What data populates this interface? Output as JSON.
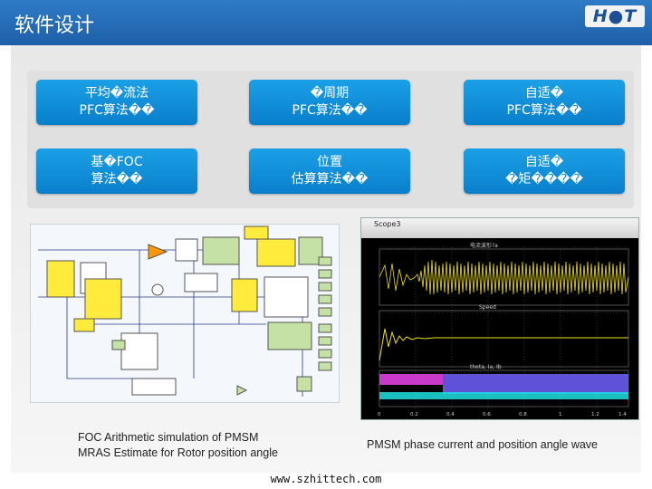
{
  "header": {
    "title": "软件设计",
    "logo": "H●T"
  },
  "boxes": [
    {
      "line1": "平均�流法",
      "line2": "PFC算法��"
    },
    {
      "line1": "�周期",
      "line2": "PFC算法��"
    },
    {
      "line1": "自适�",
      "line2": "PFC算法��"
    },
    {
      "line1": "基�FOC",
      "line2": "算法��"
    },
    {
      "line1": "位置",
      "line2": "估算算法��"
    },
    {
      "line1": "自适�",
      "line2": "�矩����"
    }
  ],
  "simulation": {
    "caption_line1": "FOC Arithmetic simulation of PMSM",
    "caption_line2": "MRAS Estimate for Rotor position angle"
  },
  "scope": {
    "window_name": "Scope3",
    "plot1_label": "电流波形?a",
    "plot2_label": "Speed",
    "plot3_label": "theta, Ia, Ib",
    "x_ticks": [
      "0",
      "0.2",
      "0.4",
      "0.6",
      "0.8",
      "1",
      "1.2",
      "1.4"
    ],
    "caption": "PMSM phase current and position angle wave"
  },
  "footer": "www.szhittech.com",
  "colors": {
    "header": "#1f5fa8",
    "box": "#0a7fcc",
    "trace_yellow": "#f0e020",
    "trace_magenta": "#e040e0",
    "trace_cyan": "#20e0e0"
  }
}
